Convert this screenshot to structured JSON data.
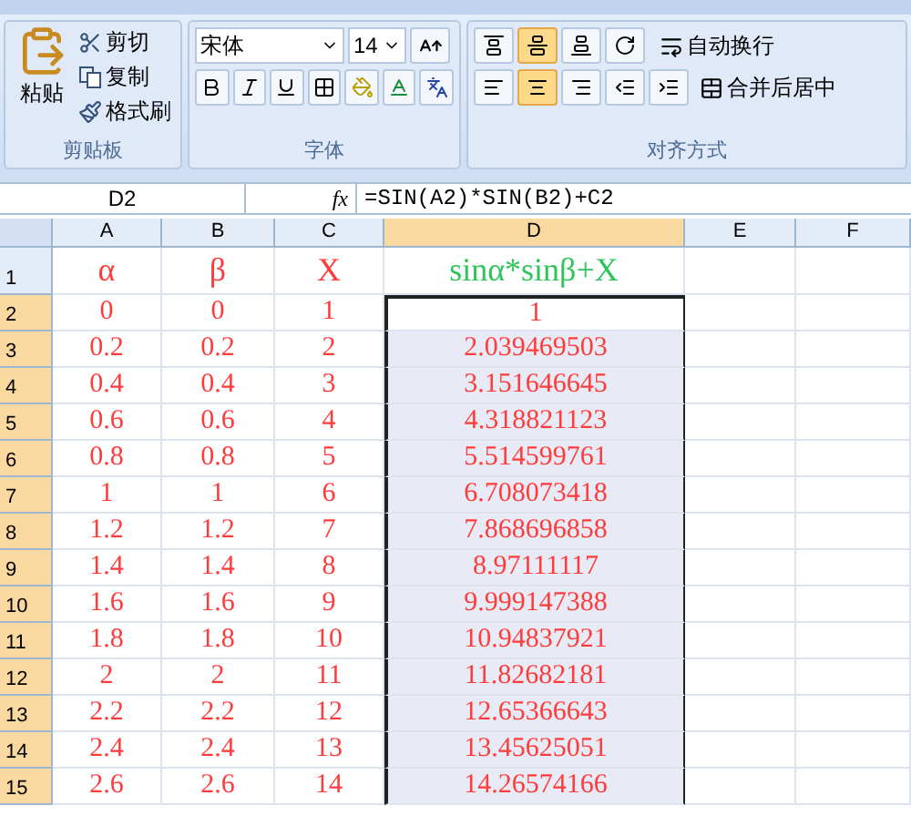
{
  "ribbon": {
    "clipboard": {
      "paste": "粘贴",
      "items": [
        "剪切",
        "复制",
        "格式刷"
      ],
      "group": "剪贴板"
    },
    "font": {
      "font_name": "宋体",
      "font_size": "14",
      "group": "字体"
    },
    "alignment": {
      "vertical": [
        {
          "selected": false
        },
        {
          "selected": true
        },
        {
          "selected": false
        }
      ],
      "horizontal": [
        {
          "selected": false
        },
        {
          "selected": true
        },
        {
          "selected": false
        }
      ],
      "wrap": "自动换行",
      "merge": "合并后居中",
      "group": "对齐方式"
    }
  },
  "formula_bar": {
    "name_box": "D2",
    "fx": "fx",
    "formula": "=SIN(A2)*SIN(B2)+C2"
  },
  "sheet": {
    "columns": [
      {
        "label": "A",
        "selected": false
      },
      {
        "label": "B",
        "selected": false
      },
      {
        "label": "C",
        "selected": false
      },
      {
        "label": "D",
        "selected": true
      },
      {
        "label": "E",
        "selected": false
      },
      {
        "label": "F",
        "selected": false
      }
    ],
    "rows": [
      {
        "label": "1",
        "selected": false,
        "cells": [
          "α",
          "β",
          "X",
          "sinα*sinβ+X"
        ]
      },
      {
        "label": "2",
        "selected": true,
        "cells": [
          "0",
          "0",
          "1",
          "1"
        ]
      },
      {
        "label": "3",
        "selected": true,
        "cells": [
          "0.2",
          "0.2",
          "2",
          "2.039469503"
        ]
      },
      {
        "label": "4",
        "selected": true,
        "cells": [
          "0.4",
          "0.4",
          "3",
          "3.151646645"
        ]
      },
      {
        "label": "5",
        "selected": true,
        "cells": [
          "0.6",
          "0.6",
          "4",
          "4.318821123"
        ]
      },
      {
        "label": "6",
        "selected": true,
        "cells": [
          "0.8",
          "0.8",
          "5",
          "5.514599761"
        ]
      },
      {
        "label": "7",
        "selected": true,
        "cells": [
          "1",
          "1",
          "6",
          "6.708073418"
        ]
      },
      {
        "label": "8",
        "selected": true,
        "cells": [
          "1.2",
          "1.2",
          "7",
          "7.868696858"
        ]
      },
      {
        "label": "9",
        "selected": true,
        "cells": [
          "1.4",
          "1.4",
          "8",
          "8.97111117"
        ]
      },
      {
        "label": "10",
        "selected": true,
        "cells": [
          "1.6",
          "1.6",
          "9",
          "9.999147388"
        ]
      },
      {
        "label": "11",
        "selected": true,
        "cells": [
          "1.8",
          "1.8",
          "10",
          "10.94837921"
        ]
      },
      {
        "label": "12",
        "selected": true,
        "cells": [
          "2",
          "2",
          "11",
          "11.82682181"
        ]
      },
      {
        "label": "13",
        "selected": true,
        "cells": [
          "2.2",
          "2.2",
          "12",
          "12.65366643"
        ]
      },
      {
        "label": "14",
        "selected": true,
        "cells": [
          "2.4",
          "2.4",
          "13",
          "13.45625051"
        ]
      },
      {
        "label": "15",
        "selected": true,
        "cells": [
          "2.6",
          "2.6",
          "14",
          "14.26574166"
        ]
      }
    ]
  }
}
